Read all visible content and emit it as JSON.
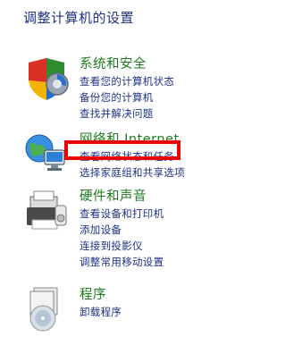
{
  "page_title": "调整计算机的设置",
  "categories": [
    {
      "title": "系统和安全",
      "icon": "shield-icon",
      "links": [
        "查看您的计算机状态",
        "备份您的计算机",
        "查找并解决问题"
      ]
    },
    {
      "title": "网络和 Internet",
      "icon": "network-globe-icon",
      "links": [
        "查看网络状态和任务",
        "选择家庭组和共享选项"
      ]
    },
    {
      "title": "硬件和声音",
      "icon": "printer-icon",
      "links": [
        "查看设备和打印机",
        "添加设备",
        "连接到投影仪",
        "调整常用移动设置"
      ]
    },
    {
      "title": "程序",
      "icon": "programs-disc-icon",
      "links": [
        "卸载程序"
      ]
    }
  ],
  "colors": {
    "category_title": "#1f7a1f",
    "link": "#1e3287",
    "highlight": "#ee0000"
  }
}
